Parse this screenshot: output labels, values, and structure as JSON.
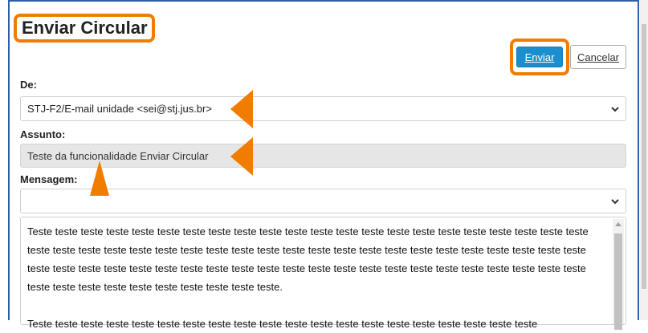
{
  "page": {
    "title": "Enviar Circular"
  },
  "actions": {
    "send_label": "Enviar",
    "cancel_label": "Cancelar"
  },
  "form": {
    "from_label": "De:",
    "from_value": "STJ-F2/E-mail unidade <sei@stj.jus.br>",
    "subject_label": "Assunto:",
    "subject_value": "Teste da funcionalidade Enviar Circular",
    "message_label": "Mensagem:",
    "message_select_value": "",
    "message_body": [
      "Teste teste teste teste teste teste teste teste teste teste teste teste teste teste teste teste teste teste teste teste teste teste teste teste teste teste teste teste teste teste teste teste teste teste teste teste teste teste teste teste teste teste teste teste teste teste teste teste teste teste teste teste teste teste teste teste teste teste teste teste teste teste teste teste teste teste teste teste teste teste teste teste teste teste teste teste.",
      "Teste teste teste teste teste teste teste teste teste teste teste teste teste teste teste teste teste teste teste teste"
    ]
  },
  "colors": {
    "accent_orange": "#f07d00",
    "send_button": "#1b8fce",
    "frame_border": "#2c5fa8",
    "readonly_bg": "#e6e6e6"
  },
  "icons": {
    "dropdown": "chevron-down-icon",
    "highlight": "arrow-pointer-icon"
  }
}
